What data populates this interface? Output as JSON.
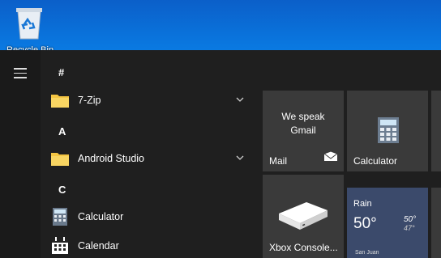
{
  "desktop": {
    "recycle_bin_label": "Recycle Bin"
  },
  "start_menu": {
    "menu_icon": "hamburger-icon",
    "sections": [
      {
        "letter": "#",
        "apps": [
          {
            "label": "7-Zip",
            "icon": "folder-icon",
            "expandable": true
          }
        ]
      },
      {
        "letter": "A",
        "apps": [
          {
            "label": "Android Studio",
            "icon": "folder-icon",
            "expandable": true
          }
        ]
      },
      {
        "letter": "C",
        "apps": [
          {
            "label": "Calculator",
            "icon": "calculator-icon",
            "expandable": false
          },
          {
            "label": "Calendar",
            "icon": "calendar-icon",
            "expandable": false
          }
        ]
      }
    ],
    "tiles": {
      "mail": {
        "headline_line1": "We speak",
        "headline_line2": "Gmail",
        "label": "Mail",
        "icon": "mail-icon"
      },
      "calculator": {
        "label": "Calculator",
        "icon": "calculator-icon"
      },
      "xbox": {
        "label": "Xbox Console...",
        "icon": "xbox-console-icon"
      },
      "weather": {
        "condition": "Rain",
        "temp": "50°",
        "high": "50°",
        "low": "47°",
        "city": "San Juan"
      }
    }
  },
  "colors": {
    "desktop_blue": "#0a6fd8",
    "menu_bg": "#1f1f1f",
    "tile_bg": "#3a3a3a",
    "folder_yellow": "#f4c542"
  }
}
